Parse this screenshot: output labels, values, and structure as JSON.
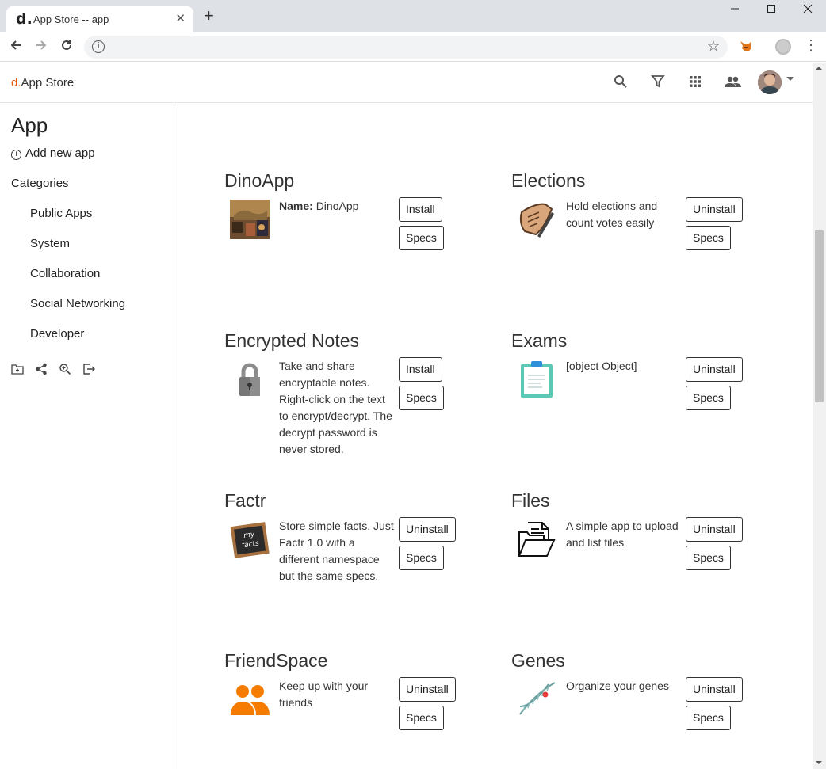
{
  "browser": {
    "tab_favicon": "d.",
    "tab_title": "App Store -- app",
    "tab_close": "✕",
    "new_tab": "+"
  },
  "header": {
    "brand_prefix": "d.",
    "brand_name": "App Store",
    "icons": [
      "search-icon",
      "filter-icon",
      "apps-grid-icon",
      "people-icon"
    ],
    "accent_color": "#e8590c"
  },
  "sidebar": {
    "title": "App",
    "add_new_app": "Add new app",
    "categories_label": "Categories",
    "categories": [
      "Public Apps",
      "System",
      "Collaboration",
      "Social Networking",
      "Developer"
    ],
    "tools": [
      "new-folder-icon",
      "share-icon",
      "zoom-icon",
      "logout-icon"
    ]
  },
  "apps": [
    {
      "name": "DinoApp",
      "desc_label": "Name:",
      "desc": "DinoApp",
      "action": "Install",
      "specs": "Specs",
      "icon": "dino-image"
    },
    {
      "name": "Elections",
      "desc": "Hold elections and count votes easily",
      "action": "Uninstall",
      "specs": "Specs",
      "icon": "ballot-icon"
    },
    {
      "name": "Encrypted Notes",
      "desc": "Take and share encryptable notes. Right-click on the text to encrypt/decrypt. The decrypt password is never stored.",
      "action": "Install",
      "specs": "Specs",
      "icon": "padlock-icon"
    },
    {
      "name": "Exams",
      "desc": "[object Object]",
      "action": "Uninstall",
      "specs": "Specs",
      "icon": "clipboard-icon"
    },
    {
      "name": "Factr",
      "desc": "Store simple facts. Just Factr 1.0 with a different namespace but the same specs.",
      "action": "Uninstall",
      "specs": "Specs",
      "icon": "chalkboard-icon",
      "icon_text": "my facts"
    },
    {
      "name": "Files",
      "desc": "A simple app to upload and list files",
      "action": "Uninstall",
      "specs": "Specs",
      "icon": "folder-files-icon"
    },
    {
      "name": "FriendSpace",
      "desc": "Keep up with your friends",
      "action": "Uninstall",
      "specs": "Specs",
      "icon": "friends-icon"
    },
    {
      "name": "Genes",
      "desc": "Organize your genes",
      "action": "Uninstall",
      "specs": "Specs",
      "icon": "dna-icon"
    }
  ]
}
